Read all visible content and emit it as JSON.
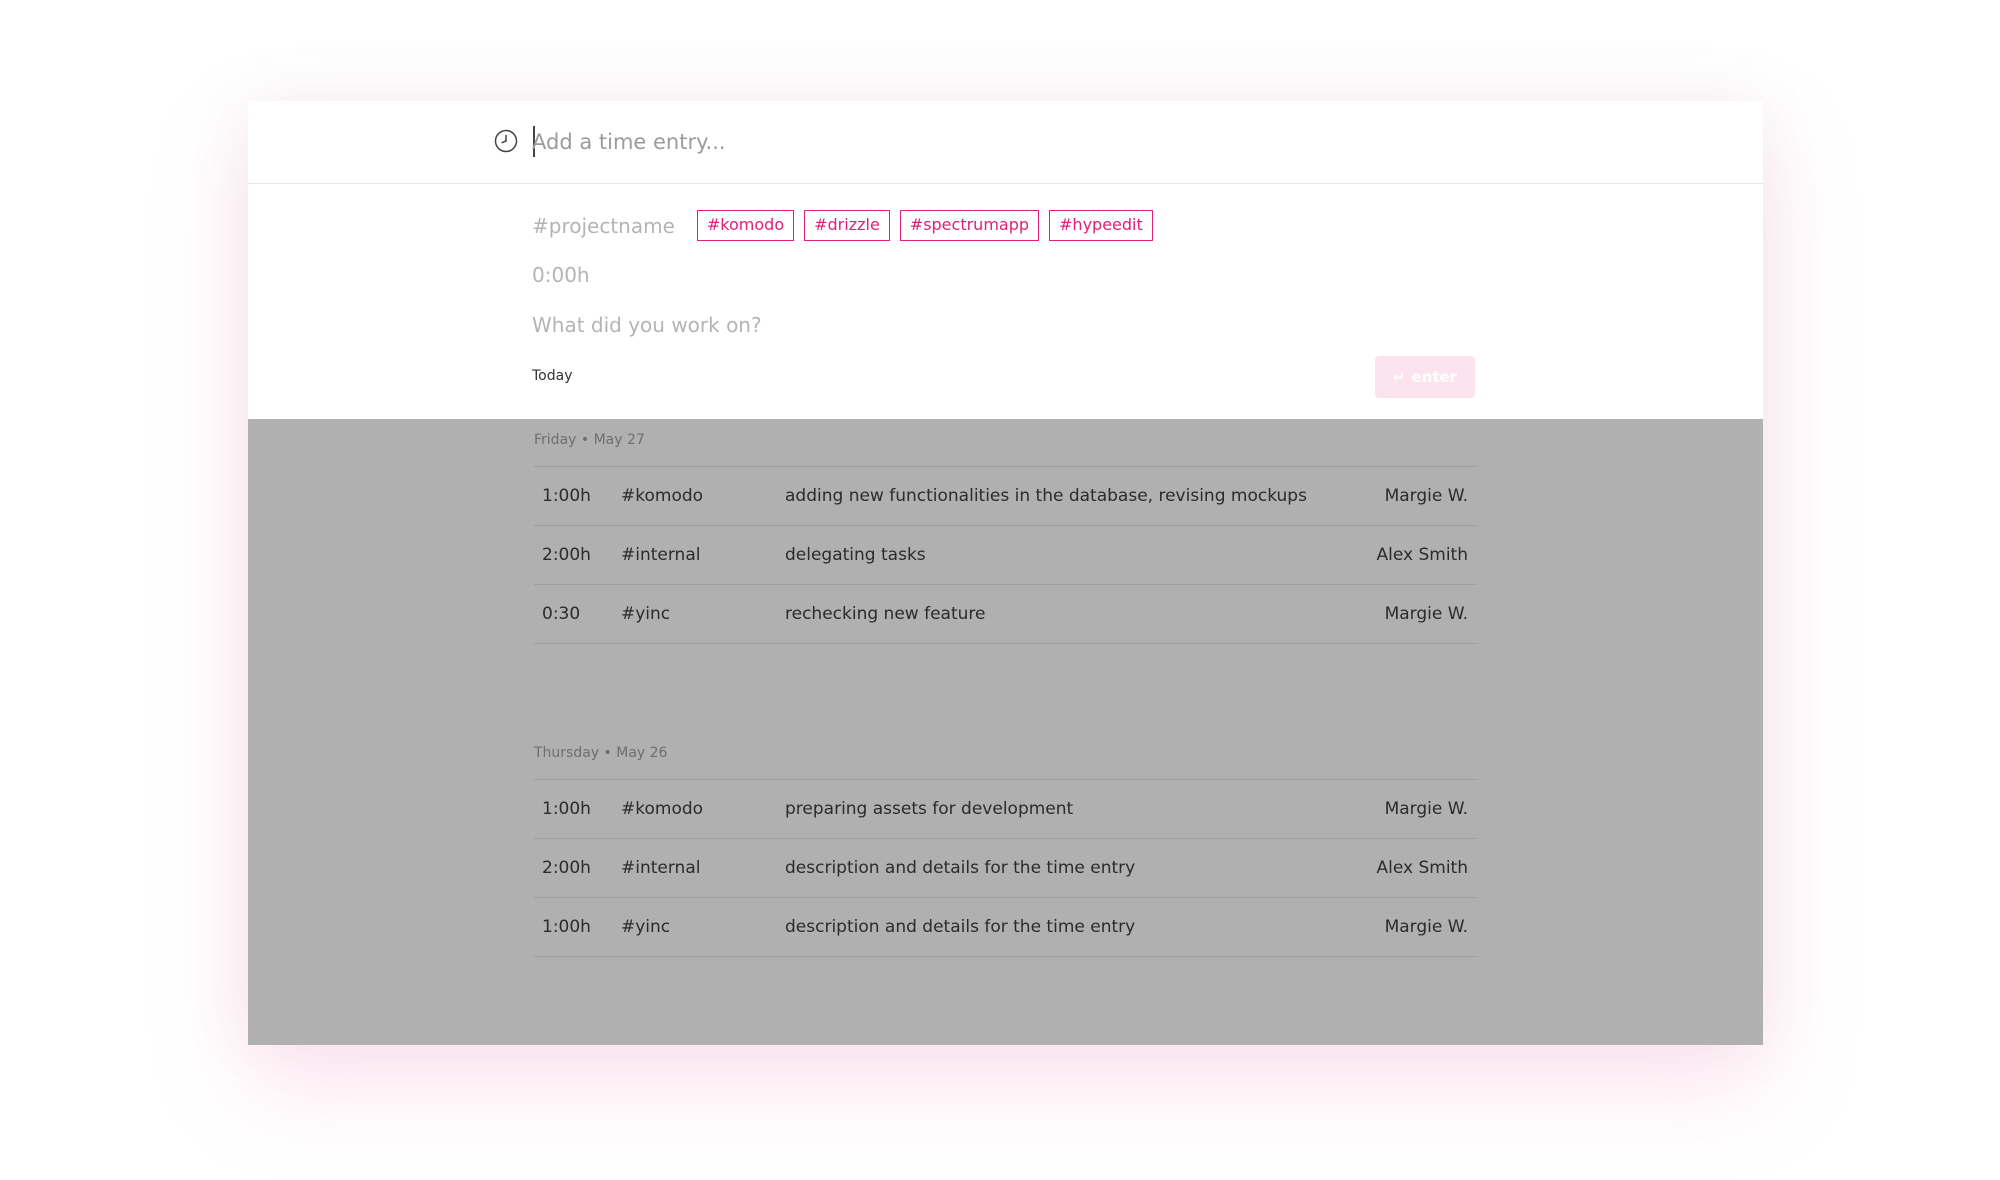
{
  "entry": {
    "placeholder": "Add a time entry..."
  },
  "composer": {
    "project_placeholder": "#projectname",
    "tags": [
      "#komodo",
      "#drizzle",
      "#spectrumapp",
      "#hypeedit"
    ],
    "hours_placeholder": "0:00h",
    "description_placeholder": "What did you work on?",
    "date_label": "Today",
    "submit_icon": "return-arrow-icon",
    "submit_label": "enter"
  },
  "colors": {
    "accent": "#e0207a",
    "button_bg": "#fde3ee",
    "overlay": "#b0b0b0"
  },
  "days": [
    {
      "label": "Friday • May 27",
      "entries": [
        {
          "time": "1:00h",
          "project": "#komodo",
          "description": "adding new functionalities in the database, revising mockups",
          "user": "Margie W."
        },
        {
          "time": "2:00h",
          "project": "#internal",
          "description": "delegating tasks",
          "user": "Alex Smith"
        },
        {
          "time": "0:30",
          "project": "#yinc",
          "description": "rechecking new feature",
          "user": "Margie W."
        }
      ]
    },
    {
      "label": "Thursday • May 26",
      "entries": [
        {
          "time": "1:00h",
          "project": "#komodo",
          "description": "preparing assets for development",
          "user": "Margie W."
        },
        {
          "time": "2:00h",
          "project": "#internal",
          "description": "description and details for the time entry",
          "user": "Alex Smith"
        },
        {
          "time": "1:00h",
          "project": "#yinc",
          "description": "description and details for the time entry",
          "user": "Margie W."
        }
      ]
    }
  ]
}
